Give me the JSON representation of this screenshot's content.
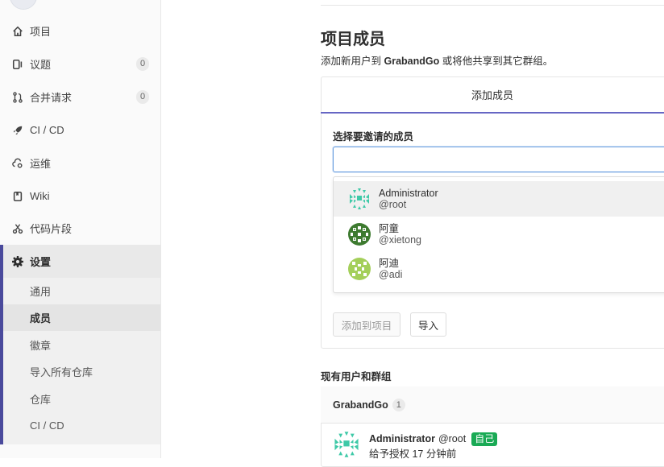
{
  "sidebar": {
    "items": [
      {
        "label": "项目",
        "icon": "home-icon"
      },
      {
        "label": "议题",
        "icon": "issues-icon",
        "count": "0"
      },
      {
        "label": "合并请求",
        "icon": "merge-request-icon",
        "count": "0"
      },
      {
        "label": "CI / CD",
        "icon": "rocket-icon"
      },
      {
        "label": "运维",
        "icon": "cloud-gear-icon"
      },
      {
        "label": "Wiki",
        "icon": "book-icon"
      },
      {
        "label": "代码片段",
        "icon": "scissors-icon"
      }
    ],
    "settings": {
      "label": "设置",
      "icon": "gear-icon",
      "children": [
        "通用",
        "成员",
        "徽章",
        "导入所有仓库",
        "仓库",
        "CI / CD"
      ],
      "active_child": "成员"
    }
  },
  "main": {
    "title": "项目成员",
    "subtitle_pre": "添加新用户到 ",
    "subtitle_project": "GrabandGo",
    "subtitle_post": " 或将他共享到其它群组。",
    "tab_label": "添加成员",
    "field_label": "选择要邀请的成员",
    "dropdown": [
      {
        "name": "Administrator",
        "username": "@root",
        "avatar_color": "#3ec9a7"
      },
      {
        "name": "阿童",
        "username": "@xietong",
        "avatar_color": "#3d7a2f"
      },
      {
        "name": "阿迪",
        "username": "@adi",
        "avatar_color": "#a4cf5a"
      }
    ],
    "add_button": "添加到项目",
    "import_button": "导入",
    "existing_title": "现有用户和群组",
    "group": {
      "name": "GrabandGo",
      "count": "1"
    },
    "member": {
      "name": "Administrator",
      "username": "@root",
      "badge": "自己",
      "granted": "给予授权 17 分钟前"
    }
  },
  "colors": {
    "accent": "#4a4a9c",
    "focus": "#6b9fe0",
    "success": "#1aaa55"
  }
}
